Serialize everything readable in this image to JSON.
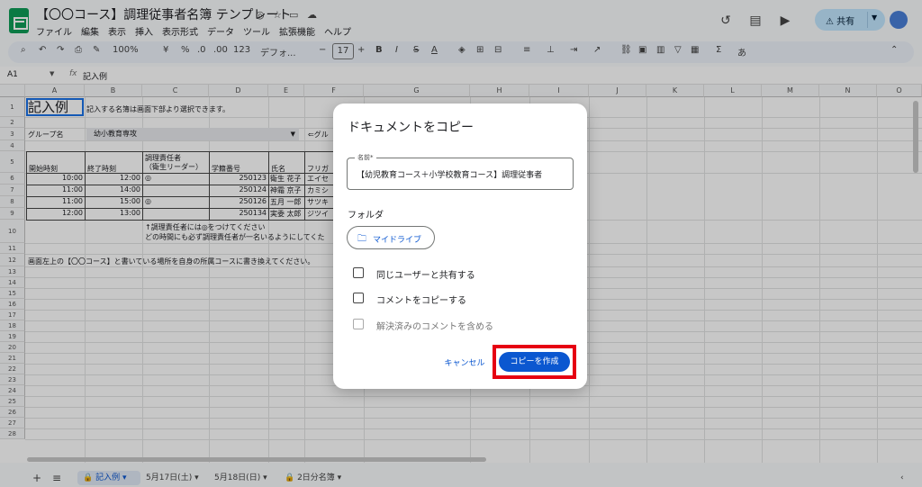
{
  "app": {
    "title": "【〇〇コース】調理従事者名簿 テンプレート",
    "menu": [
      "ファイル",
      "編集",
      "表示",
      "挿入",
      "表示形式",
      "データ",
      "ツール",
      "拡張機能",
      "ヘルプ"
    ],
    "share_label": "共有",
    "brand_color": "#0f9d58",
    "accent_color": "#0b57d0"
  },
  "toolbar": {
    "zoom": "100%",
    "currency": "¥",
    "percent": "%",
    "decimal_dec": ".0",
    "decimal_inc": ".00",
    "number_format": "123",
    "font": "デフォ...",
    "font_size": "17",
    "bold": "B",
    "italic": "I",
    "text_color": "A",
    "sum": "Σ",
    "input_tool": "あ"
  },
  "formula_bar": {
    "cell_ref": "A1",
    "fx": "fx",
    "content": "記入例"
  },
  "sheet": {
    "columns": [
      "A",
      "B",
      "C",
      "D",
      "E",
      "F",
      "G",
      "H",
      "I",
      "J",
      "K",
      "L",
      "M",
      "N",
      "O"
    ],
    "rows": [
      "1",
      "2",
      "3",
      "4",
      "5",
      "6",
      "7",
      "8",
      "9",
      "10",
      "11",
      "12",
      "13",
      "14",
      "15",
      "16",
      "17",
      "18",
      "19",
      "20",
      "21",
      "22",
      "23",
      "24",
      "25",
      "26",
      "27",
      "28"
    ],
    "a1": "記入例",
    "b1": "記入する名簿は画面下部より選択できます。",
    "group_label": "グループ名",
    "group_value": "幼小教育専攻",
    "group_note": "⇐グル",
    "header_start": "開始時刻",
    "header_end": "終了時刻",
    "header_responsible_1": "調理責任者",
    "header_responsible_2": "（衛生リーダー）",
    "header_student_no": "学籍番号",
    "header_name": "氏名",
    "header_kana": "フリガ",
    "entries": [
      {
        "start": "10:00",
        "end": "12:00",
        "mark": "◎",
        "no": "250123",
        "name": "衛生 花子",
        "kana": "エイセ"
      },
      {
        "start": "11:00",
        "end": "14:00",
        "mark": "",
        "no": "250124",
        "name": "神霜 京子",
        "kana": "カミシ"
      },
      {
        "start": "11:00",
        "end": "15:00",
        "mark": "◎",
        "no": "250126",
        "name": "五月 一郎",
        "kana": "サツキ"
      },
      {
        "start": "12:00",
        "end": "13:00",
        "mark": "",
        "no": "250134",
        "name": "実委 太郎",
        "kana": "ジツイ"
      }
    ],
    "note_1": "↑調理責任者には◎をつけてください",
    "note_2": "どの時間にも必ず調理責任者が一名いるようにしてくた",
    "note_3": "画面左上の【〇〇コース】と書いている場所を自身の所属コースに書き換えてください。"
  },
  "bottom_tabs": {
    "add": "+",
    "list": "≡",
    "tabs": [
      "記入例",
      "5月17日(土)",
      "5月18日(日)",
      "2日分名簿"
    ]
  },
  "dialog": {
    "title": "ドキュメントをコピー",
    "name_label": "名前*",
    "name_value": "【幼児教育コース＋小学校教育コース】調理従事者",
    "folder_heading": "フォルダ",
    "folder_button": "マイドライブ",
    "options": [
      {
        "label": "同じユーザーと共有する",
        "checked": false,
        "disabled": false
      },
      {
        "label": "コメントをコピーする",
        "checked": false,
        "disabled": false
      },
      {
        "label": "解決済みのコメントを含める",
        "checked": false,
        "disabled": true
      }
    ],
    "cancel": "キャンセル",
    "create": "コピーを作成",
    "highlight_color": "#e60012"
  }
}
